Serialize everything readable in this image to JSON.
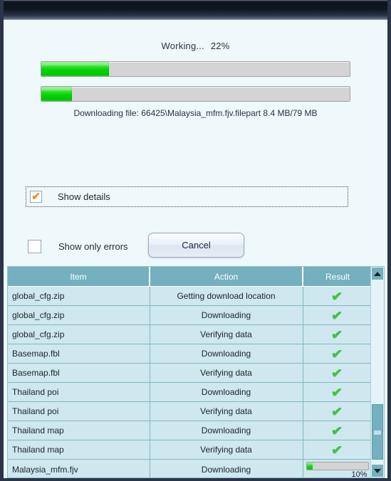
{
  "window": {
    "title": "",
    "accent_teal": "#74b0bd",
    "background": "#eff9fc",
    "progress_green": "#00d000",
    "check_orange": "#f08a20"
  },
  "progress": {
    "status_label": "Working...",
    "status_percent": "22%",
    "overall_percent": 22,
    "file_percent": 10,
    "file_line": "Downloading file:  66425\\Malaysia_mfm.fjv.filepart 8.4 MB/79 MB"
  },
  "options": {
    "show_details_label": "Show details",
    "show_details_checked": true,
    "show_details_mark": "✔",
    "show_only_errors_label": "Show only errors",
    "show_only_errors_checked": false
  },
  "buttons": {
    "cancel_label": "Cancel"
  },
  "table": {
    "columns": [
      "Item",
      "Action",
      "Result"
    ],
    "rows": [
      {
        "item": "global_cfg.zip",
        "action": "Getting download location",
        "result": "check",
        "result_mark": "✔"
      },
      {
        "item": "global_cfg.zip",
        "action": "Downloading",
        "result": "check",
        "result_mark": "✔"
      },
      {
        "item": "global_cfg.zip",
        "action": "Verifying data",
        "result": "check",
        "result_mark": "✔"
      },
      {
        "item": "Basemap.fbl",
        "action": "Downloading",
        "result": "check",
        "result_mark": "✔"
      },
      {
        "item": "Basemap.fbl",
        "action": "Verifying data",
        "result": "check",
        "result_mark": "✔"
      },
      {
        "item": "Thailand poi",
        "action": "Downloading",
        "result": "check",
        "result_mark": "✔"
      },
      {
        "item": "Thailand poi",
        "action": "Verifying data",
        "result": "check",
        "result_mark": "✔"
      },
      {
        "item": "Thailand map",
        "action": "Downloading",
        "result": "check",
        "result_mark": "✔"
      },
      {
        "item": "Thailand map",
        "action": "Verifying data",
        "result": "check",
        "result_mark": "✔"
      },
      {
        "item": "Malaysia_mfm.fjv",
        "action": "Downloading",
        "result": "progress",
        "result_percent": 10,
        "result_percent_label": "10%"
      }
    ]
  },
  "scrollbar": {
    "up_arrow": "scroll-up",
    "down_arrow": "scroll-down",
    "thumb_position": "near-bottom"
  }
}
